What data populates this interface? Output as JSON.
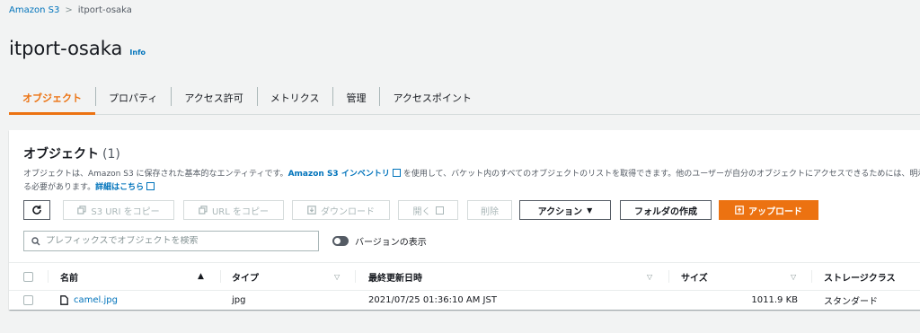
{
  "breadcrumb": {
    "root": "Amazon S3",
    "current": "itport-osaka"
  },
  "page": {
    "title": "itport-osaka",
    "info": "Info"
  },
  "tabs": [
    "オブジェクト",
    "プロパティ",
    "アクセス許可",
    "メトリクス",
    "管理",
    "アクセスポイント"
  ],
  "panel": {
    "title": "オブジェクト",
    "count": "(1)",
    "desc_1a": "オブジェクトは、Amazon S3 に保存された基本的なエンティティです。",
    "desc_link1": "Amazon S3 インベントリ",
    "desc_1b": "を使用して、バケット内のすべてのオブジェクトのリストを取得できます。他のユーザーが自分のオブジェクトにアクセスできるためには、明示",
    "desc_2a": "る必要があります。",
    "desc_link2": "詳細はこちら"
  },
  "toolbar": {
    "copy_s3_uri": "S3 URI をコピー",
    "copy_url": "URL をコピー",
    "download": "ダウンロード",
    "open": "開く",
    "delete": "削除",
    "actions": "アクション",
    "create_folder": "フォルダの作成",
    "upload": "アップロード"
  },
  "search": {
    "placeholder": "プレフィックスでオブジェクトを検索"
  },
  "version_toggle": {
    "label": "バージョンの表示"
  },
  "table": {
    "columns": [
      "名前",
      "タイプ",
      "最終更新日時",
      "サイズ",
      "ストレージクラス"
    ],
    "rows": [
      {
        "name": "camel.jpg",
        "type": "jpg",
        "modified": "2021/07/25 01:36:10 AM JST",
        "size": "1011.9 KB",
        "storage": "スタンダード"
      }
    ]
  },
  "colors": {
    "accent": "#ec7211",
    "link": "#0073bb"
  }
}
